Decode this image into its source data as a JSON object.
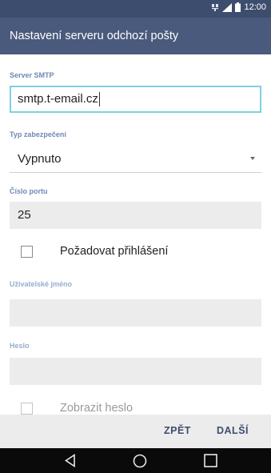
{
  "status_bar": {
    "time": "12:00",
    "icons": [
      "network-icon",
      "signal-icon",
      "battery-icon"
    ]
  },
  "app_bar": {
    "title": "Nastavení serveru odchozí pošty"
  },
  "form": {
    "server_label": "Server SMTP",
    "server_value": "smtp.t-email.cz",
    "security_label": "Typ zabezpečení",
    "security_value": "Vypnuto",
    "port_label": "Číslo portu",
    "port_value": "25",
    "require_login_label": "Požadovat přihlášení",
    "require_login_checked": false,
    "username_label": "Uživatelské jméno",
    "username_value": "",
    "password_label": "Heslo",
    "password_value": "",
    "show_password_label": "Zobrazit heslo",
    "show_password_checked": false
  },
  "footer": {
    "back_label": "ZPĚT",
    "next_label": "DALŠÍ"
  },
  "nav_bar": {
    "icons": [
      "back-icon",
      "home-icon",
      "recents-icon"
    ]
  },
  "colors": {
    "status_bar": "#3d4d6e",
    "app_bar": "#4a5a7c",
    "label": "#6f88b6",
    "focus_border": "#7fd0e0",
    "disabled_field": "#ececec"
  }
}
